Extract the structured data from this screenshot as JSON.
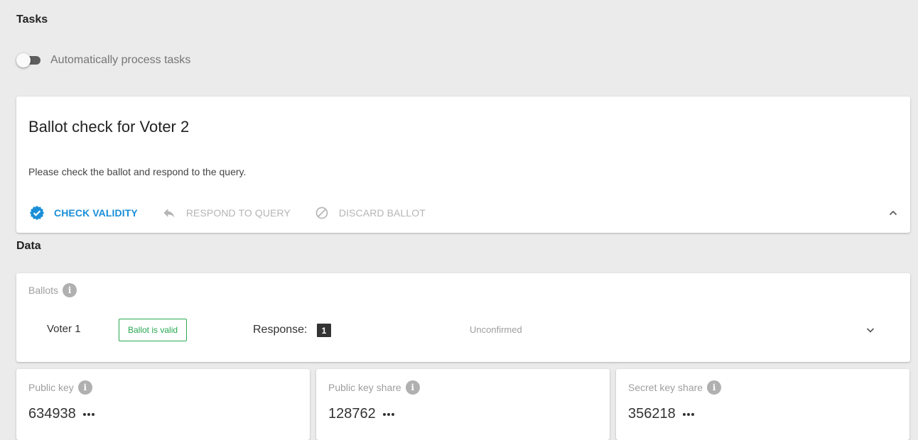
{
  "tasks_section": {
    "title": "Tasks",
    "auto_process_label": "Automatically process tasks"
  },
  "task_card": {
    "title": "Ballot check for Voter 2",
    "description": "Please check the ballot and respond to the query.",
    "actions": {
      "check_validity": "CHECK VALIDITY",
      "respond_to_query": "RESPOND TO QUERY",
      "discard_ballot": "DISCARD BALLOT"
    }
  },
  "data_section": {
    "title": "Data"
  },
  "ballots": {
    "label": "Ballots",
    "rows": [
      {
        "voter": "Voter 1",
        "badge": "Ballot is valid",
        "response_label": "Response:",
        "response_value": "1",
        "status": "Unconfirmed"
      }
    ]
  },
  "keys": {
    "public_key": {
      "label": "Public key",
      "value": "634938"
    },
    "public_key_share": {
      "label": "Public key share",
      "value": "128762"
    },
    "secret_key_share": {
      "label": "Secret key share",
      "value": "356218"
    }
  },
  "colors": {
    "accent": "#1a8fd8",
    "valid": "#27a850",
    "background": "#ebebeb"
  },
  "icons": {
    "check_validity": "verified-badge-icon",
    "respond": "reply-icon",
    "discard": "block-icon",
    "info": "info-icon",
    "more": "more-horizontal-icon"
  }
}
